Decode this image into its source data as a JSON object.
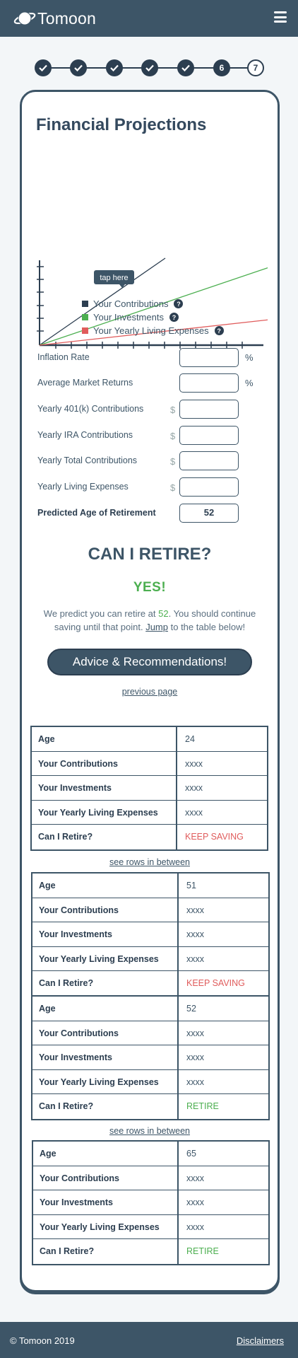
{
  "header": {
    "brand": "Tomoon",
    "menu_icon": "hamburger-menu-icon"
  },
  "stepper": {
    "steps": [
      "",
      "",
      "",
      "",
      "",
      "6",
      "7"
    ],
    "completed_icon": "check-icon",
    "current_step": 7
  },
  "card": {
    "title": "Financial Projections",
    "chart": {
      "tooltip": "tap here"
    },
    "legend": [
      {
        "label": "Your Contributions",
        "color": "#2c3e50"
      },
      {
        "label": "Your Investments",
        "color": "#4caf50"
      },
      {
        "label": "Your Yearly Living Expenses",
        "color": "#e05c5c"
      }
    ],
    "form": {
      "inflation": {
        "label": "Inflation Rate",
        "value": "",
        "unit": "%"
      },
      "market": {
        "label": "Average Market Returns",
        "value": "",
        "unit": "%"
      },
      "k401": {
        "label": "Yearly 401(k) Contributions",
        "value": "",
        "unit": "$"
      },
      "ira": {
        "label": "Yearly IRA Contributions",
        "value": "",
        "unit": "$"
      },
      "total": {
        "label": "Yearly Total Contributions",
        "value": "",
        "unit": "$"
      },
      "living": {
        "label": "Yearly Living Expenses",
        "value": "",
        "unit": "$"
      },
      "age": {
        "label": "Predicted Age of Retirement",
        "value": "52"
      }
    },
    "result": {
      "heading": "CAN I RETIRE?",
      "answer": "YES!",
      "sentence_a": "We predict you can retire at ",
      "age": "52",
      "sentence_b": ". You should continue saving until that point. ",
      "jump": "Jump",
      "sentence_c": " to the table below!"
    },
    "advice_button": "Advice & Recommendations!",
    "previous_page": "previous page",
    "row_labels": {
      "age": "Age",
      "contrib": "Your Contributions",
      "invest": "Your Investments",
      "living": "Your Yearly Living Expenses",
      "retire": "Can I Retire?"
    },
    "see_between": "see rows in between",
    "tables": [
      {
        "age": "24",
        "contrib": "xxxx",
        "invest": "xxxx",
        "living": "xxxx",
        "retire": "KEEP SAVING"
      },
      {
        "age": "51",
        "contrib": "xxxx",
        "invest": "xxxx",
        "living": "xxxx",
        "retire": "KEEP SAVING"
      },
      {
        "age": "52",
        "contrib": "xxxx",
        "invest": "xxxx",
        "living": "xxxx",
        "retire": "RETIRE"
      },
      {
        "age": "65",
        "contrib": "xxxx",
        "invest": "xxxx",
        "living": "xxxx",
        "retire": "RETIRE"
      }
    ]
  },
  "footer": {
    "copyright": "© Tomoon 2019",
    "disclaimers": "Disclaimers"
  }
}
